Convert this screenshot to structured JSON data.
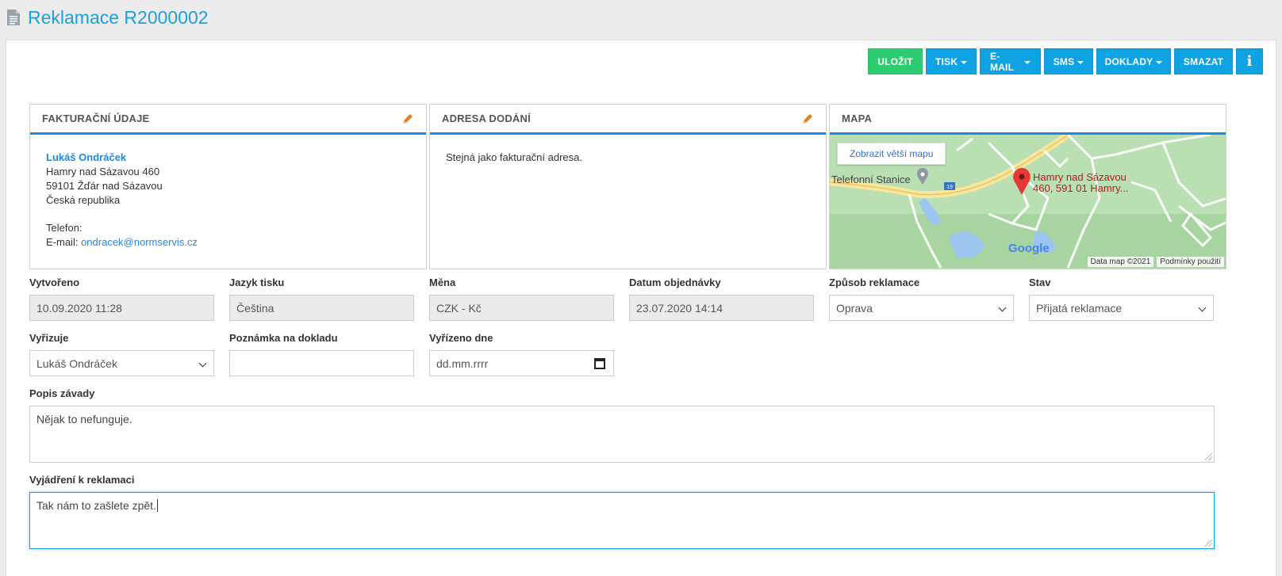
{
  "page": {
    "title": "Reklamace R2000002"
  },
  "toolbar": {
    "save": "ULOŽIT",
    "print": "TISK",
    "email": "E-MAIL",
    "sms": "SMS",
    "documents": "DOKLADY",
    "delete": "SMAZAT",
    "info": "i"
  },
  "billing": {
    "title": "FAKTURAČNÍ ÚDAJE",
    "name": "Lukáš Ondráček",
    "street": "Hamry nad Sázavou 460",
    "city": "59101 Žďár nad Sázavou",
    "country": "Česká republika",
    "phone_label": "Telefon:",
    "email_label": "E-mail:",
    "email": "ondracek@normservis.cz"
  },
  "delivery": {
    "title": "ADRESA DODÁNÍ",
    "text": "Stejná jako fakturační adresa."
  },
  "map": {
    "title": "MAPA",
    "bigger_map": "Zobrazit větší mapu",
    "pin_label_1": "Hamry nad Sázavou",
    "pin_label_2": "460, 591 01 Hamry...",
    "poi": "Telefonní Stanice",
    "road_number": "19",
    "map_data": "Data map ©2021",
    "terms": "Podmínky použití",
    "logo": "Google"
  },
  "form": {
    "created": {
      "label": "Vytvořeno",
      "value": "10.09.2020 11:28"
    },
    "print_lang": {
      "label": "Jazyk tisku",
      "value": "Čeština"
    },
    "currency": {
      "label": "Měna",
      "value": "CZK - Kč"
    },
    "order_date": {
      "label": "Datum objednávky",
      "value": "23.07.2020 14:14"
    },
    "method": {
      "label": "Způsob reklamace",
      "value": "Oprava"
    },
    "status": {
      "label": "Stav",
      "value": "Přijatá reklamace"
    },
    "handler": {
      "label": "Vyřizuje",
      "value": "Lukáš Ondráček"
    },
    "note": {
      "label": "Poznámka na dokladu",
      "value": ""
    },
    "resolved": {
      "label": "Vyřízeno dne",
      "placeholder": "dd.mm.rrrr"
    },
    "defect": {
      "label": "Popis závady",
      "value": "Nějak to nefunguje."
    },
    "response": {
      "label": "Vyjádření k reklamaci",
      "value": "Tak nám to zašlete zpět."
    }
  },
  "colors": {
    "title": "#1e9fd8",
    "save": "#2ecc71",
    "button": "#0fa3e3",
    "card_accent": "#1e88e5"
  }
}
